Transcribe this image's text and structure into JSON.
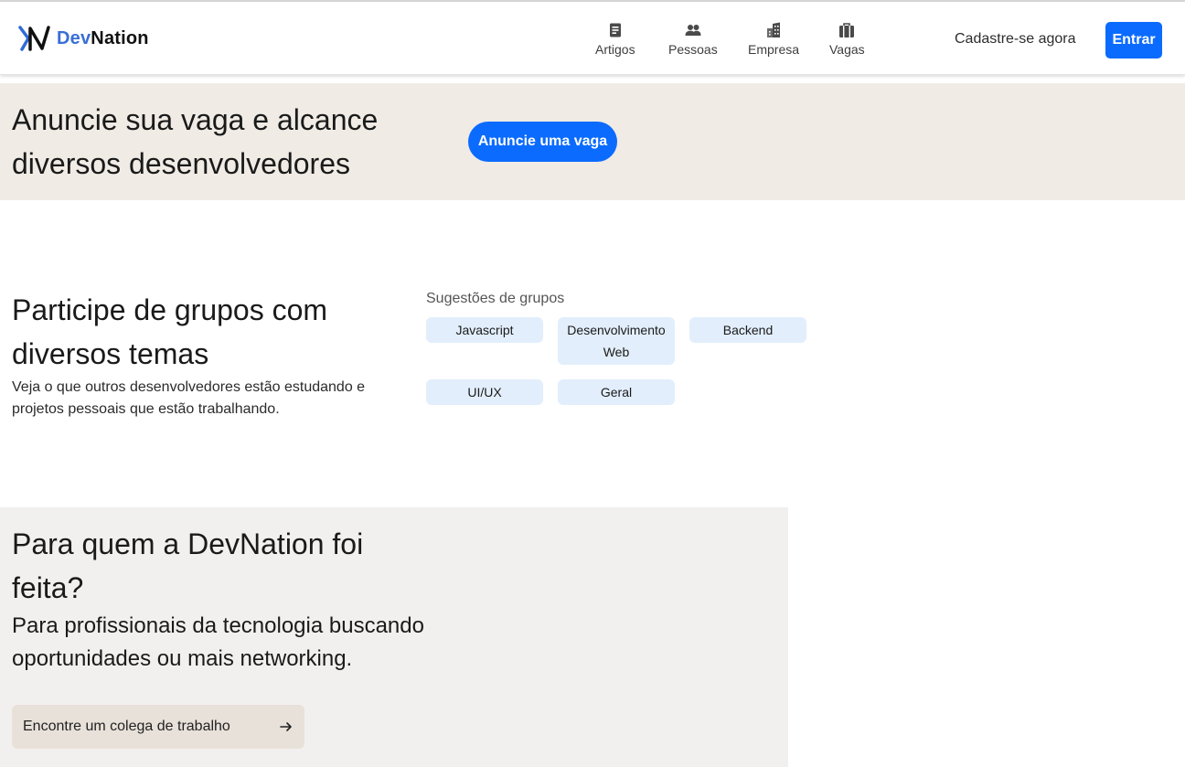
{
  "nav": {
    "logo": {
      "dev": "Dev",
      "nation": "Nation"
    },
    "items": [
      {
        "label": "Artigos",
        "icon": "article-icon"
      },
      {
        "label": "Pessoas",
        "icon": "people-icon"
      },
      {
        "label": "Empresa",
        "icon": "building-icon"
      },
      {
        "label": "Vagas",
        "icon": "briefcase-icon"
      }
    ],
    "signup": "Cadastre-se agora",
    "login": "Entrar"
  },
  "banner": {
    "title": "Anuncie sua vaga e alcance diversos desenvolvedores",
    "button": "Anuncie uma vaga"
  },
  "groups": {
    "title": "Participe de grupos com diversos temas",
    "description": "Veja o que outros desenvolvedores estão estudando e projetos pessoais que estão trabalhando.",
    "suggestions_label": "Sugestões de grupos",
    "chips": [
      "Javascript",
      "Desenvolvimento Web",
      "Backend",
      "UI/UX",
      "Geral"
    ]
  },
  "forwho": {
    "title": "Para quem a DevNation foi feita?",
    "description": "Para profissionais da tecnologia buscando oportunidades ou mais networking.",
    "button": "Encontre um colega de trabalho"
  },
  "colors": {
    "accent": "#0b6bff",
    "banner_bg": "#f0ebe5",
    "chip_bg": "#e2eefb",
    "section_bg": "#f2f0ee"
  }
}
